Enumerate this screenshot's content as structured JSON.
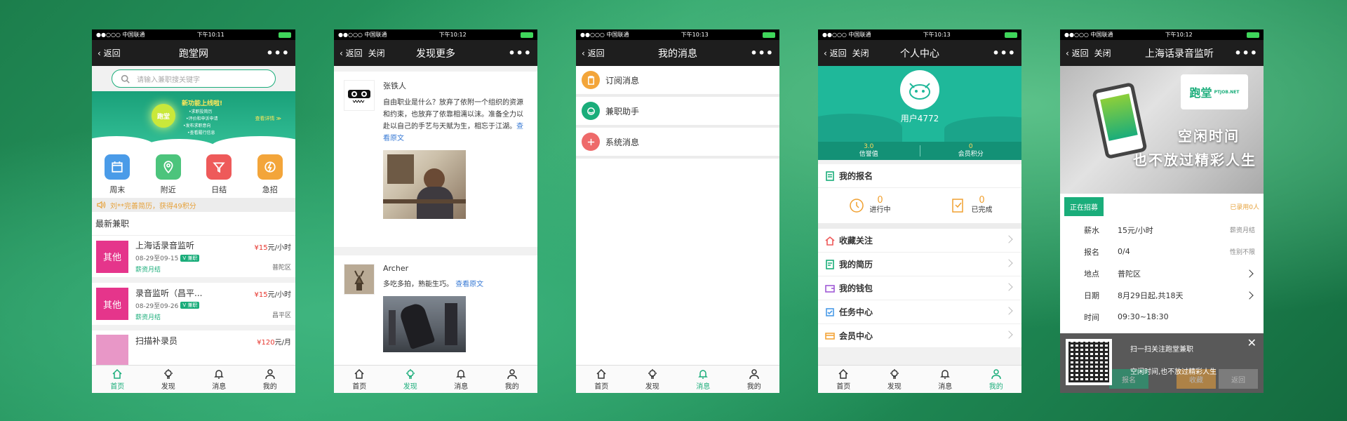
{
  "status": {
    "carrier": "●●○○○ 中国联通",
    "times": [
      "下午10:11",
      "下午10:12",
      "下午10:13",
      "下午10:13",
      "下午10:12"
    ]
  },
  "nav": {
    "back": "返回",
    "close": "关闭",
    "more": "•••"
  },
  "tabs": [
    "首页",
    "发现",
    "消息",
    "我的"
  ],
  "s1": {
    "title": "跑堂网",
    "search_placeholder": "请输入兼职搜关键字",
    "banner": {
      "badge": "跑堂",
      "new": "新功能上线啦!",
      "features": [
        "•求职投简历",
        "•评价和申诉申请",
        "•发布求职意向",
        "•查看履行信息"
      ],
      "link": "查看详情 ≫"
    },
    "cats": [
      {
        "label": "周末",
        "color": "#4a9be8"
      },
      {
        "label": "附近",
        "color": "#4cc47c"
      },
      {
        "label": "日结",
        "color": "#ee5a5a"
      },
      {
        "label": "急招",
        "color": "#f3a53a"
      }
    ],
    "notice": "刘**完善简历，获得49积分",
    "section": "最新兼职",
    "jobs": [
      {
        "tag": "其他",
        "title": "上海话录音监听",
        "date": "08-29至09-15",
        "badge": "V 兼职",
        "settle": "薪资月结",
        "price": "¥15",
        "unit": "元/小时",
        "area": "普陀区",
        "color": "#e5358b"
      },
      {
        "tag": "其他",
        "title": "录音监听（昌平...",
        "date": "08-29至09-26",
        "badge": "V 兼职",
        "settle": "薪资月结",
        "price": "¥15",
        "unit": "元/小时",
        "area": "昌平区",
        "color": "#e5358b"
      },
      {
        "tag": "",
        "title": "扫描补录员",
        "date": "",
        "badge": "",
        "settle": "",
        "price": "¥120",
        "unit": "元/月",
        "area": "",
        "color": "#e897c7"
      }
    ]
  },
  "s2": {
    "title": "发现更多",
    "posts": [
      {
        "name": "张铁人",
        "text": "自由职业是什么？放弃了依附一个组织的资源和约束，也放弃了依靠相濡以沫。准备全力以赴以自己的手艺与天赋为生，相忘于江湖。",
        "link": "查看原文"
      },
      {
        "name": "Archer",
        "text": "多吃多拍，熟能生巧。",
        "link": "查看原文"
      }
    ]
  },
  "s3": {
    "title": "我的消息",
    "items": [
      {
        "label": "订阅消息",
        "color": "#f3a53a"
      },
      {
        "label": "兼职助手",
        "color": "#1aad7a"
      },
      {
        "label": "系统消息",
        "color": "#ee6a6a"
      }
    ]
  },
  "s4": {
    "title": "个人中心",
    "user": "用户4772",
    "credit_v": "3.0",
    "credit_l": "信誉值",
    "points_v": "0",
    "points_l": "会员积分",
    "signup": "我的报名",
    "ongoing_n": "0",
    "ongoing": "进行中",
    "done_n": "0",
    "done": "已完成",
    "menu": [
      "收藏关注",
      "我的简历",
      "我的钱包",
      "任务中心",
      "会员中心"
    ]
  },
  "s5": {
    "title": "上海话录音监听",
    "logo": "跑堂",
    "logo_sub": "PTJOB.NET",
    "slogan1": "空闲时间",
    "slogan2": "也不放过精彩人生",
    "recruit": "正在招募",
    "signed": "已录用0人",
    "rows": [
      {
        "k": "薪水",
        "v": "15元/小时",
        "side": "薪资月结"
      },
      {
        "k": "报名",
        "v": "0/4",
        "side": "性别不限"
      },
      {
        "k": "地点",
        "v": "普陀区",
        "side": ""
      },
      {
        "k": "日期",
        "v": "8月29日起,共18天",
        "side": ""
      },
      {
        "k": "时间",
        "v": "09:30~18:30",
        "side": ""
      }
    ],
    "qr1": "扫一扫关注跑堂兼职",
    "qr2": "空闲时间,也不放过精彩人生",
    "btns": [
      "报名",
      "收藏",
      "返回"
    ]
  }
}
